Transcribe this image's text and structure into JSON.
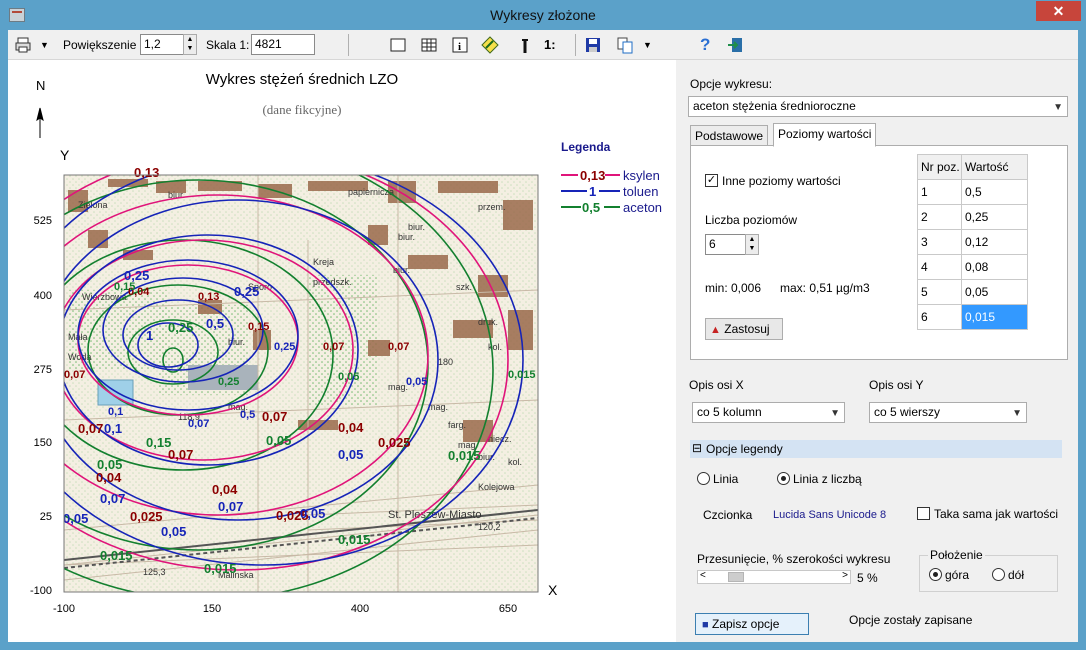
{
  "window": {
    "title": "Wykresy złożone"
  },
  "toolbar": {
    "zoom_label": "Powiększenie",
    "zoom_value": "1,2",
    "scale_label": "Skala 1:",
    "scale_value": "4821",
    "scale_tool_label": "1:",
    "help_label": "?"
  },
  "chart": {
    "title": "Wykres stężeń średnich  LZO",
    "subtitle": "(dane fikcyjne)",
    "north_label": "N",
    "y_axis_label": "Y",
    "x_axis_label": "X",
    "y_ticks": [
      "525",
      "400",
      "275",
      "150",
      "25",
      "-100"
    ],
    "x_ticks": [
      "-100",
      "150",
      "400",
      "650"
    ],
    "legend_title": "Legenda",
    "legend": [
      {
        "value": "0,13",
        "name": "ksylen",
        "color": "#e0147a"
      },
      {
        "value": "1",
        "name": "toluen",
        "color": "#1624b8"
      },
      {
        "value": "0,5",
        "name": "aceton",
        "color": "#13802f"
      }
    ],
    "labels_dark": [
      "0,13",
      "0,13",
      "0,07",
      "0,07",
      "0,04",
      "0,04",
      "0,025",
      "0,025",
      "0,04",
      "0,07",
      "0,025",
      "0,07",
      "0,07",
      "0,07",
      "0,04",
      "0,15"
    ],
    "labels_blue": [
      "0,25",
      "0,5",
      "1",
      "0,25",
      "0,1",
      "0,07",
      "0,05",
      "0,05",
      "0,05",
      "0,05",
      "0,07",
      "0,25",
      "0,5",
      "0,05",
      "0,07",
      "0,1"
    ],
    "labels_green": [
      "0,25",
      "0,15",
      "0,05",
      "0,05",
      "0,015",
      "0,015",
      "0,015",
      "0,015",
      "0,015",
      "0,05",
      "0,25",
      "0,15"
    ],
    "map_texts": [
      "Zielona",
      "biur.",
      "papiernicza",
      "biur.",
      "przem.",
      "Wierzbowa",
      "Mała",
      "Woda",
      "Sporo",
      "biur.",
      "biur.",
      "Kreja",
      "przedszk.",
      "biur.",
      "szk.",
      "druk.",
      "kol.",
      "118,9",
      "mag.",
      "mag.",
      "mag.",
      "farg.",
      "mag.",
      "biur.",
      "niecz.",
      "kol.",
      "St. Pleszew-Miasto",
      "Kolejowa",
      "125,3",
      "Malinska",
      "120,2",
      "180"
    ]
  },
  "options": {
    "chart_options_label": "Opcje wykresu:",
    "chart_options_value": "aceton stężenia średnioroczne",
    "tabs": [
      "Podstawowe",
      "Poziomy wartości"
    ],
    "other_levels_label": "Inne poziomy wartości",
    "other_levels_checked": true,
    "levels_count_label": "Liczba poziomów",
    "levels_count_value": "6",
    "min_label": "min: 0,006",
    "max_label": "max: 0,51 µg/m3",
    "apply_button": "Zastosuj",
    "table_headers": [
      "Nr poz.",
      "Wartość"
    ],
    "table_rows": [
      {
        "nr": "1",
        "value": "0,5"
      },
      {
        "nr": "2",
        "value": "0,25"
      },
      {
        "nr": "3",
        "value": "0,12"
      },
      {
        "nr": "4",
        "value": "0,08"
      },
      {
        "nr": "5",
        "value": "0,05"
      },
      {
        "nr": "6",
        "value": "0,015"
      }
    ],
    "x_axis_label": "Opis osi X",
    "x_axis_value": "co 5 kolumn",
    "y_axis_label": "Opis osi Y",
    "y_axis_value": "co 5 wierszy",
    "legend_section": "Opcje legendy",
    "legend_section_toggle": "⊟",
    "line_label": "Linia",
    "line_number_label": "Linia z liczbą",
    "line_number_selected": true,
    "font_label": "Czcionka",
    "font_value": "Lucida Sans Unicode  8",
    "same_as_values_label": "Taka sama jak wartości",
    "offset_label": "Przesunięcie, % szerokości wykresu",
    "offset_value": "5 %",
    "offset_fraction": 0.05,
    "position_label": "Położenie",
    "position_top": "góra",
    "position_bottom": "dół",
    "position_selected": "góra",
    "save_button": "Zapisz opcje",
    "saved_message": "Opcje zostały zapisane"
  }
}
